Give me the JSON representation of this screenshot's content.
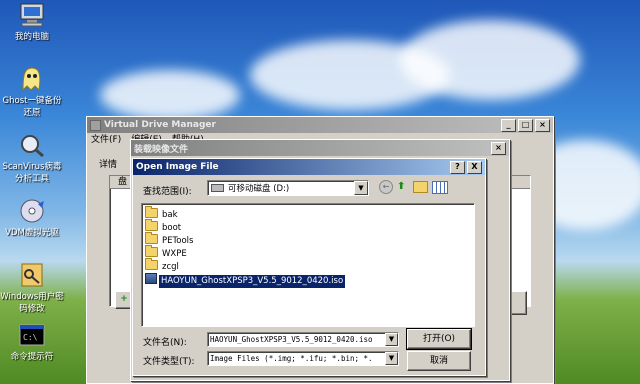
{
  "desktop": {
    "icons": [
      {
        "label": "我的电脑",
        "icon": "my-computer-icon"
      },
      {
        "label": "Ghost一键备份还原",
        "icon": "ghost-icon"
      },
      {
        "label": "ScanVirus病毒分析工具",
        "icon": "scanvirus-icon"
      },
      {
        "label": "VDM虚拟光驱",
        "icon": "vdm-icon"
      },
      {
        "label": "Windows用户密码修改",
        "icon": "password-icon"
      },
      {
        "label": "命令提示符",
        "icon": "cmd-icon"
      }
    ]
  },
  "vdm_window": {
    "title": "Virtual Drive Manager",
    "menu": [
      "文件(F)",
      "编辑(E)",
      "帮助(H)"
    ],
    "tab": "详情",
    "column": "盘",
    "add_label": "+"
  },
  "load_window": {
    "title": "装载映像文件"
  },
  "open_dialog": {
    "title": "Open Image File",
    "look_in_label": "查找范围(I):",
    "look_in_value": "可移动磁盘 (D:)",
    "items": [
      {
        "name": "bak",
        "type": "folder"
      },
      {
        "name": "boot",
        "type": "folder"
      },
      {
        "name": "PETools",
        "type": "folder"
      },
      {
        "name": "WXPE",
        "type": "folder"
      },
      {
        "name": "zcgl",
        "type": "folder"
      },
      {
        "name": "HAOYUN_GhostXPSP3_V5.5_9012_0420.iso",
        "type": "iso",
        "selected": true
      }
    ],
    "filename_label": "文件名(N):",
    "filename_value": "HAOYUN_GhostXPSP3_V5.5_9012_0420.iso",
    "filetype_label": "文件类型(T):",
    "filetype_value": "Image Files (*.img; *.ifu; *.bin; *.",
    "open_button": "打开(O)",
    "cancel_button": "取消",
    "help_button": "?",
    "close_button": "X"
  },
  "colors": {
    "titlebar_active": "#0a246a",
    "dialog_bg": "#d4d0c8",
    "selection": "#0a246a"
  }
}
